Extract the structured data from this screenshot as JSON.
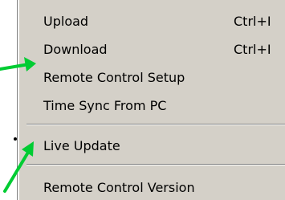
{
  "menu": {
    "items": [
      {
        "label": "Upload",
        "shortcut": "Ctrl+I"
      },
      {
        "label": "Download",
        "shortcut": "Ctrl+I"
      },
      {
        "label": "Remote Control Setup",
        "shortcut": ""
      },
      {
        "label": "Time Sync From PC",
        "shortcut": ""
      },
      {
        "label": "Live Update",
        "shortcut": ""
      },
      {
        "label": "Remote Control Version",
        "shortcut": ""
      }
    ]
  },
  "colors": {
    "menu_background": "#d4d0c8",
    "arrow": "#00cc33"
  }
}
